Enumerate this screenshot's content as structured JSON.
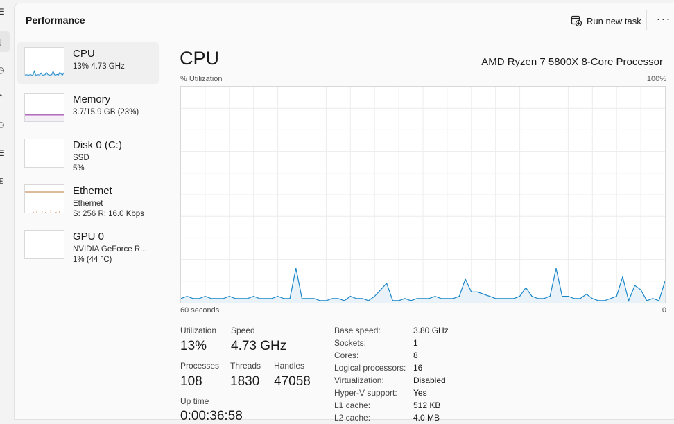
{
  "header": {
    "title": "Performance",
    "run_new_task_label": "Run new task",
    "more_label": "···"
  },
  "sidebar": {
    "icons": [
      "menu-icon",
      "performance-icon",
      "history-icon",
      "startup-icon",
      "users-icon",
      "details-icon",
      "services-icon"
    ]
  },
  "devices": [
    {
      "title": "CPU",
      "line1": "13%  4.73 GHz",
      "line2": ""
    },
    {
      "title": "Memory",
      "line1": "3.7/15.9 GB (23%)",
      "line2": ""
    },
    {
      "title": "Disk 0 (C:)",
      "line1": "SSD",
      "line2": "5%"
    },
    {
      "title": "Ethernet",
      "line1": "Ethernet",
      "line2": "S: 256  R: 16.0 Kbps"
    },
    {
      "title": "GPU 0",
      "line1": "NVIDIA GeForce R...",
      "line2": "1%  (44 °C)"
    }
  ],
  "main": {
    "title": "CPU",
    "processor": "AMD Ryzen 7 5800X 8-Core Processor",
    "util_label": "% Utilization",
    "max_label": "100%",
    "time_label": "60 seconds",
    "zero_label": "0"
  },
  "chart_data": {
    "type": "area",
    "y_range": [
      0,
      100
    ],
    "x_range_seconds": [
      60,
      0
    ],
    "grid": true,
    "color": "#1a86c8",
    "fill": "#e9f2f9",
    "values": [
      2,
      3,
      2,
      2,
      3,
      2,
      2,
      2,
      3,
      2,
      2,
      2,
      3,
      2,
      2,
      2,
      3,
      2,
      2,
      16,
      2,
      2,
      2,
      1,
      1,
      2,
      2,
      1,
      3,
      2,
      2,
      1,
      3,
      6,
      9,
      1,
      1,
      2,
      1,
      2,
      2,
      2,
      3,
      2,
      2,
      2,
      3,
      11,
      5,
      5,
      4,
      3,
      2,
      2,
      2,
      2,
      3,
      7,
      3,
      2,
      2,
      3,
      16,
      3,
      3,
      2,
      2,
      4,
      2,
      1,
      1,
      2,
      3,
      12,
      1,
      8,
      6,
      1,
      2,
      1,
      10
    ]
  },
  "stats": {
    "utilization_label": "Utilization",
    "utilization": "13%",
    "speed_label": "Speed",
    "speed": "4.73 GHz",
    "processes_label": "Processes",
    "processes": "108",
    "threads_label": "Threads",
    "threads": "1830",
    "handles_label": "Handles",
    "handles": "47058",
    "uptime_label": "Up time",
    "uptime": "0:00:36:58"
  },
  "specs": [
    {
      "label": "Base speed:",
      "value": "3.80 GHz"
    },
    {
      "label": "Sockets:",
      "value": "1"
    },
    {
      "label": "Cores:",
      "value": "8"
    },
    {
      "label": "Logical processors:",
      "value": "16"
    },
    {
      "label": "Virtualization:",
      "value": "Disabled"
    },
    {
      "label": "Hyper-V support:",
      "value": "Yes"
    },
    {
      "label": "L1 cache:",
      "value": "512 KB"
    },
    {
      "label": "L2 cache:",
      "value": "4.0 MB"
    }
  ],
  "thumbnails": {
    "cpu": [
      2,
      3,
      2,
      2,
      3,
      2,
      2,
      16,
      2,
      2,
      3,
      2,
      9,
      2,
      2,
      3,
      11,
      4,
      2,
      2,
      3,
      16,
      3,
      2,
      4,
      2,
      12,
      6,
      2,
      10
    ],
    "memory_pct": 23,
    "ethernet": [
      0,
      0,
      0,
      1,
      0,
      3,
      0,
      0,
      2,
      0,
      1,
      0,
      0,
      4,
      0,
      0,
      1,
      0,
      2,
      0
    ]
  }
}
